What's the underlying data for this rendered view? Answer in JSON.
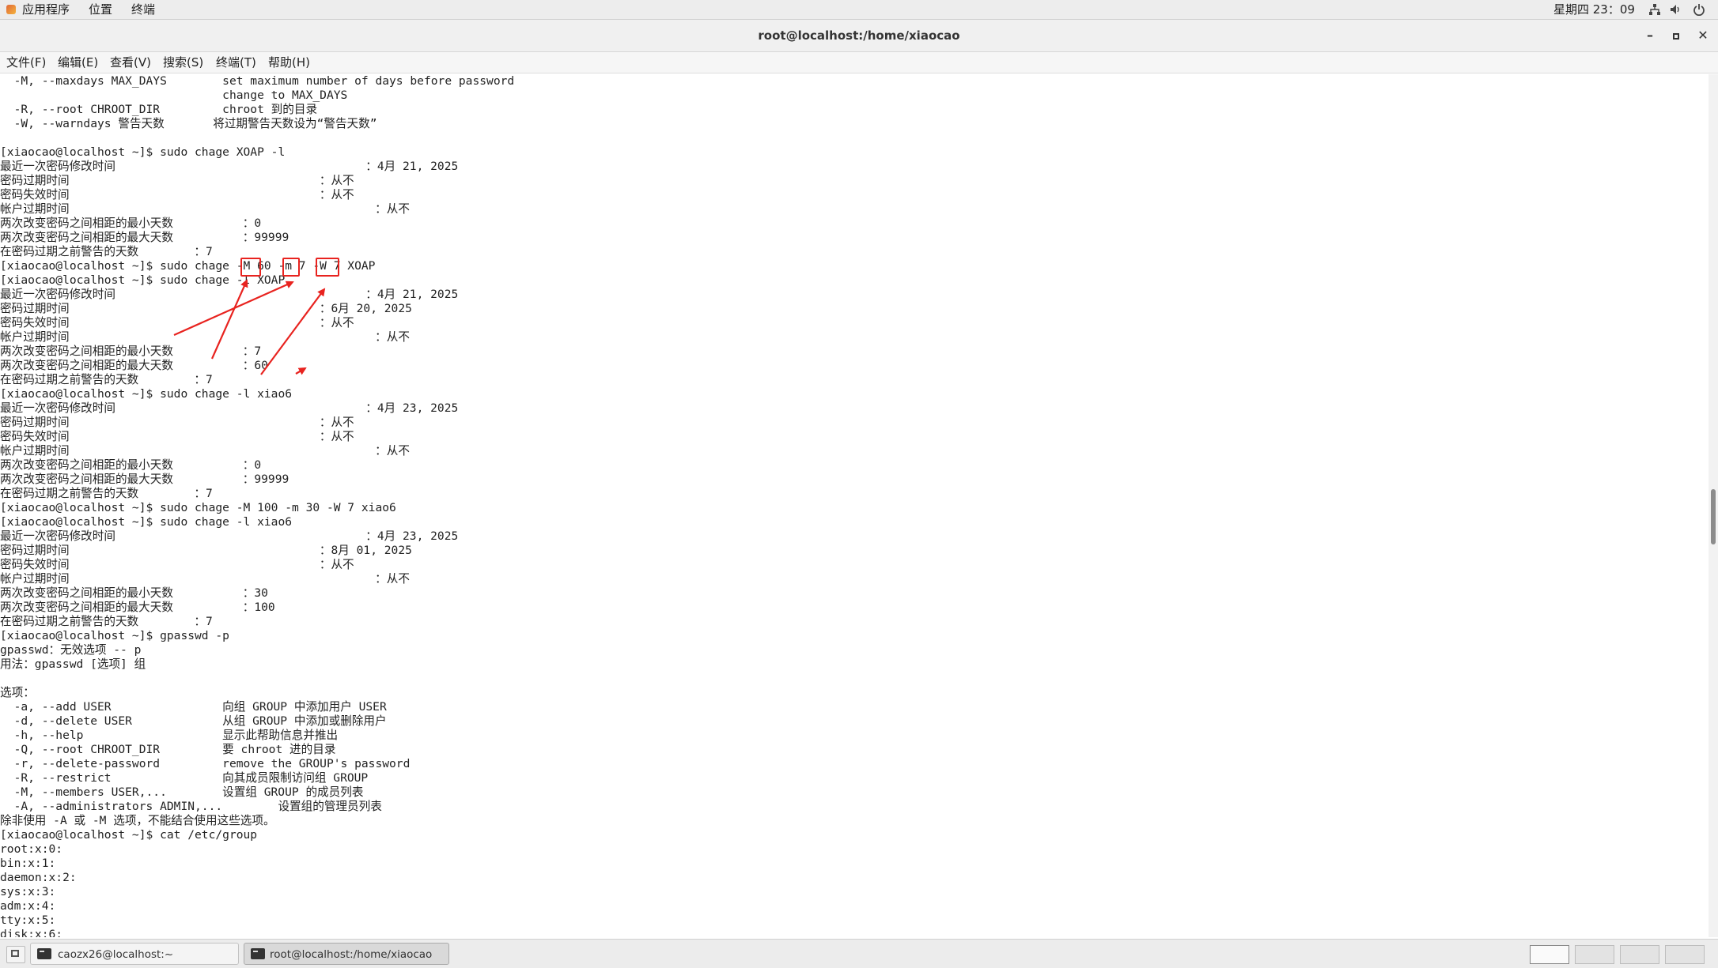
{
  "top_panel": {
    "applications": "应用程序",
    "places": "位置",
    "terminal": "终端",
    "clock": "星期四 23：09",
    "tray_icons": [
      "network-icon",
      "volume-icon",
      "power-icon"
    ]
  },
  "window": {
    "title": "root@localhost:/home/xiaocao"
  },
  "menubar": [
    "文件(F)",
    "编辑(E)",
    "查看(V)",
    "搜索(S)",
    "终端(T)",
    "帮助(H)"
  ],
  "terminal_lines": [
    "  -M, --maxdays MAX_DAYS        set maximum number of days before password",
    "                                change to MAX_DAYS",
    "  -R, --root CHROOT_DIR         chroot 到的目录",
    "  -W, --warndays 警告天数       将过期警告天数设为“警告天数”",
    "",
    "[xiaocao@localhost ~]$ sudo chage XOAP -l",
    "最近一次密码修改时间                                    ：4月 21, 2025",
    "密码过期时间                                    ：从不",
    "密码失效时间                                    ：从不",
    "帐户过期时间                                            ：从不",
    "两次改变密码之间相距的最小天数          ：0",
    "两次改变密码之间相距的最大天数          ：99999",
    "在密码过期之前警告的天数        ：7",
    "[xiaocao@localhost ~]$ sudo chage -M 60 -m 7 -W 7 XOAP",
    "[xiaocao@localhost ~]$ sudo chage -l XOAP",
    "最近一次密码修改时间                                    ：4月 21, 2025",
    "密码过期时间                                    ：6月 20, 2025",
    "密码失效时间                                    ：从不",
    "帐户过期时间                                            ：从不",
    "两次改变密码之间相距的最小天数          ：7",
    "两次改变密码之间相距的最大天数          ：60",
    "在密码过期之前警告的天数        ：7",
    "[xiaocao@localhost ~]$ sudo chage -l xiao6",
    "最近一次密码修改时间                                    ：4月 23, 2025",
    "密码过期时间                                    ：从不",
    "密码失效时间                                    ：从不",
    "帐户过期时间                                            ：从不",
    "两次改变密码之间相距的最小天数          ：0",
    "两次改变密码之间相距的最大天数          ：99999",
    "在密码过期之前警告的天数        ：7",
    "[xiaocao@localhost ~]$ sudo chage -M 100 -m 30 -W 7 xiao6",
    "[xiaocao@localhost ~]$ sudo chage -l xiao6",
    "最近一次密码修改时间                                    ：4月 23, 2025",
    "密码过期时间                                    ：8月 01, 2025",
    "密码失效时间                                    ：从不",
    "帐户过期时间                                            ：从不",
    "两次改变密码之间相距的最小天数          ：30",
    "两次改变密码之间相距的最大天数          ：100",
    "在密码过期之前警告的天数        ：7",
    "[xiaocao@localhost ~]$ gpasswd -p",
    "gpasswd：无效选项 -- p",
    "用法：gpasswd [选项] 组",
    "",
    "选项：",
    "  -a, --add USER                向组 GROUP 中添加用户 USER",
    "  -d, --delete USER             从组 GROUP 中添加或删除用户",
    "  -h, --help                    显示此帮助信息并推出",
    "  -Q, --root CHROOT_DIR         要 chroot 进的目录",
    "  -r, --delete-password         remove the GROUP's password",
    "  -R, --restrict                向其成员限制访问组 GROUP",
    "  -M, --members USER,...        设置组 GROUP 的成员列表",
    "  -A, --administrators ADMIN,...        设置组的管理员列表",
    "除非使用 -A 或 -M 选项，不能结合使用这些选项。",
    "[xiaocao@localhost ~]$ cat /etc/group",
    "root:x:0:",
    "bin:x:1:",
    "daemon:x:2:",
    "sys:x:3:",
    "adm:x:4:",
    "tty:x:5:",
    "disk:x:6:"
  ],
  "taskbar": {
    "tasks": [
      {
        "label": "caozx26@localhost:~",
        "active": false
      },
      {
        "label": "root@localhost:/home/xiaocao",
        "active": true
      }
    ],
    "workspaces": 4,
    "current_workspace": 1
  },
  "colors": {
    "annotation": "#e8231f",
    "background": "#ffffff",
    "text": "#222222"
  }
}
